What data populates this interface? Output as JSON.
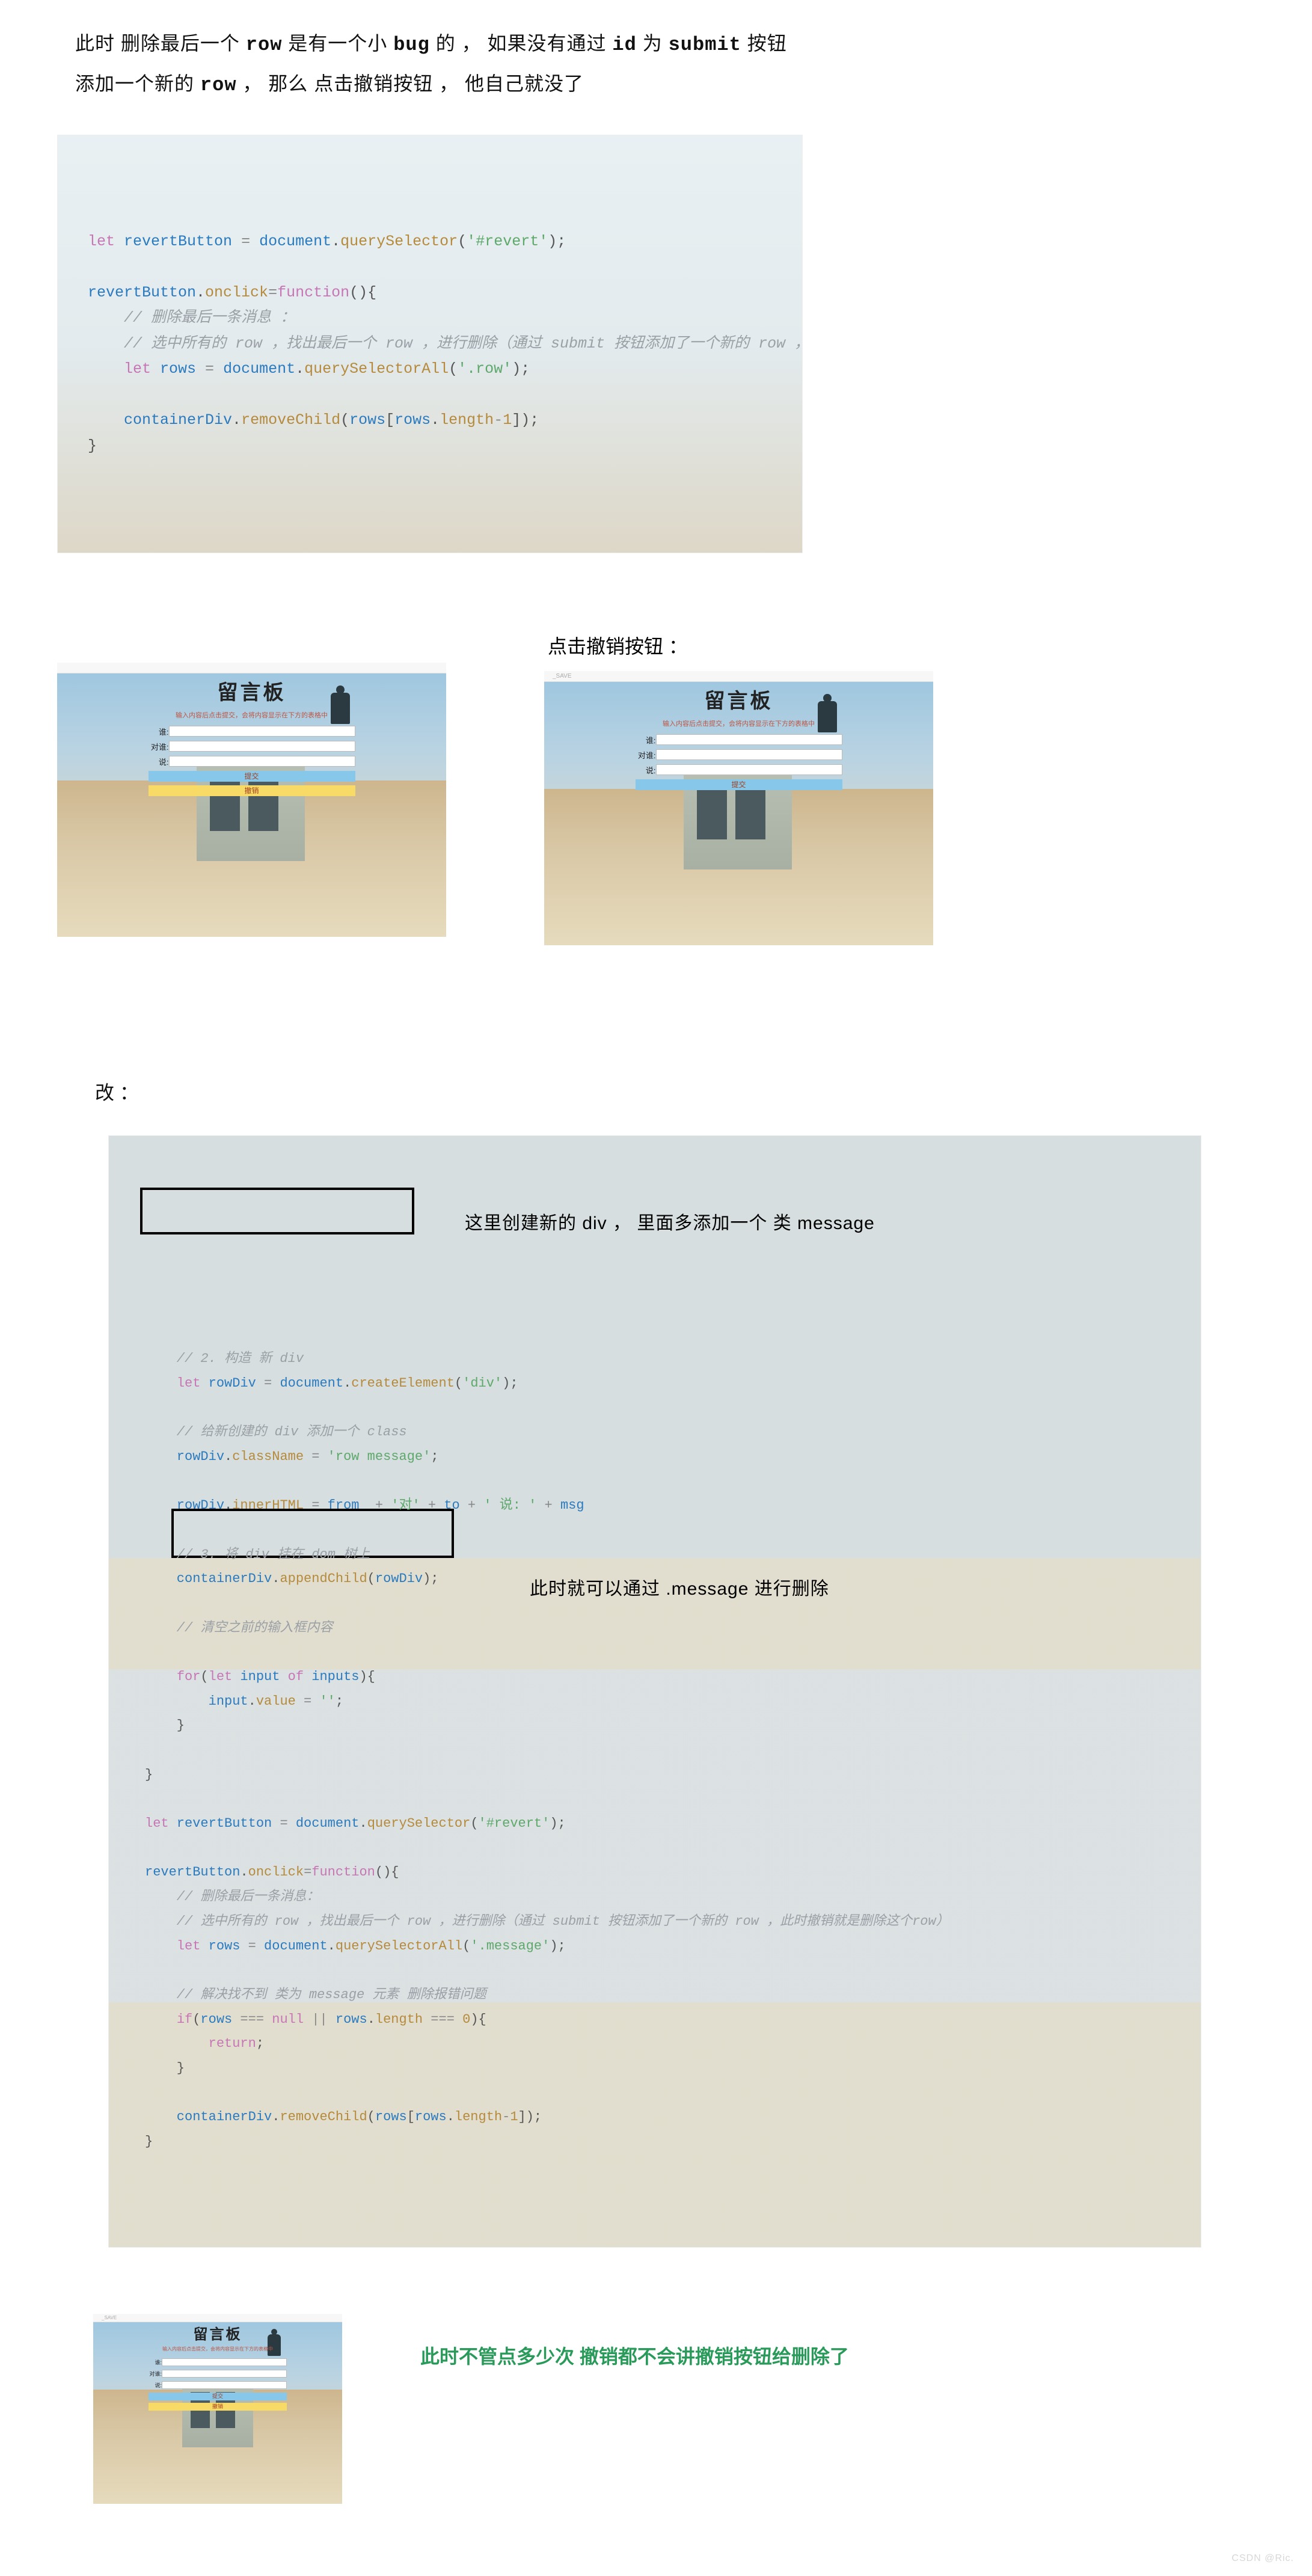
{
  "intro_para": {
    "line1_seg1": "此时 删除最后一个 ",
    "line1_row": "row",
    "line1_seg2": " 是有一个小 ",
    "line1_bug": "bug",
    "line1_seg3": " 的 ， 如果没有通过 ",
    "line1_id": "id",
    "line1_seg4": " 为 ",
    "line1_submit": "submit",
    "line1_seg5": " 按钮",
    "line2_seg1": "添加一个新的 ",
    "line2_row": "row",
    "line2_seg2": " ， 那么 点击撤销按钮 ， 他自己就没了"
  },
  "code1": {
    "l1_let": "let",
    "l1_var": " revertButton",
    "l1_eq": " = ",
    "l1_doc": "document",
    "l1_dot": ".",
    "l1_fn": "querySelector",
    "l1_par": "(",
    "l1_str": "'#revert'",
    "l1_end": ");",
    "l2_a": "revertButton",
    "l2_b": ".",
    "l2_c": "onclick",
    "l2_d": "=",
    "l2_e": "function",
    "l2_f": "(){",
    "c1": "    // 删除最后一条消息 ：",
    "c2": "    // 选中所有的 row ，找出最后一个 row ，进行删除（通过 submit 按钮添加了一个新的 row ，此时撤销就是删除这个row）",
    "l3_a": "    ",
    "l3_let": "let",
    "l3_var": " rows",
    "l3_eq": " = ",
    "l3_doc": "document",
    "l3_dot": ".",
    "l3_fn": "querySelectorAll",
    "l3_par": "(",
    "l3_str": "'.row'",
    "l3_end": ");",
    "l4_a": "    containerDiv",
    "l4_dot": ".",
    "l4_fn": "removeChild",
    "l4_par": "(",
    "l4_rows": "rows",
    "l4_br": "[",
    "l4_rows2": "rows",
    "l4_dot2": ".",
    "l4_len": "length",
    "l4_minus": "-",
    "l4_one": "1",
    "l4_end": "]);",
    "l5": "}"
  },
  "shot_label": "点击撤销按钮 ：",
  "board": {
    "title": "留言板",
    "sub": "输入内容后点击提交，会将内容显示在下方的表格中",
    "label_who": "谁:",
    "label_to": "对谁:",
    "label_say": "说:",
    "submit": "提交",
    "revert": "撤销",
    "tab": "_SAVE"
  },
  "section_fix": "改 ：",
  "code2": {
    "c1": "    // 2. 构造 新 div",
    "l1": "    let rowDiv = document.createElement('div');",
    "l1_let": "let",
    "l1_id": " rowDiv",
    "l1_eq": " = ",
    "l1_doc": "document",
    "l1_dot": ".",
    "l1_fn": "createElement",
    "l1_p": "(",
    "l1_s": "'div'",
    "l1_e": ");",
    "c2": "    // 给新创建的 div 添加一个 class",
    "l2_a": "    rowDiv",
    "l2_dot": ".",
    "l2_cls": "className",
    "l2_eq": " = ",
    "l2_s": "'row message'",
    "l2_e": ";",
    "l3_a": "    rowDiv",
    "l3_dot": ".",
    "l3_ih": "innerHTML",
    "l3_eq": " = ",
    "l3_from": "from",
    "l3_p2": "  + ",
    "l3_s1": "'对'",
    "l3_p3": " + ",
    "l3_to": "to",
    "l3_p4": " + ",
    "l3_s2": "' 说: '",
    "l3_p5": " + ",
    "l3_msg": "msg",
    "c3": "    // 3. 将 div 挂在 dom 树上",
    "l4_a": "    containerDiv",
    "l4_dot": ".",
    "l4_fn": "appendChild",
    "l4_p": "(",
    "l4_r": "rowDiv",
    "l4_e": ");",
    "c4": "    // 清空之前的输入框内容",
    "l5_a": "    ",
    "l5_for": "for",
    "l5_p": "(",
    "l5_let": "let",
    "l5_inp": " input ",
    "l5_of": "of",
    "l5_ins": " inputs",
    "l5_pe": "){",
    "l6": "        input.value = '';",
    "l6_a": "        input",
    "l6_dot": ".",
    "l6_v": "value",
    "l6_eq": " = ",
    "l6_s": "''",
    "l6_e": ";",
    "l7": "    }",
    "l8": "}",
    "l9_let": "let",
    "l9_v": " revertButton",
    "l9_eq": " = ",
    "l9_doc": "document",
    "l9_dot": ".",
    "l9_fn": "querySelector",
    "l9_p": "(",
    "l9_s": "'#revert'",
    "l9_e": ");",
    "l10_a": "revertButton",
    "l10_dot": ".",
    "l10_c": "onclick",
    "l10_eq": "=",
    "l10_fn": "function",
    "l10_p": "(){",
    "c5": "    // 删除最后一条消息：",
    "c6": "    // 选中所有的 row ，找出最后一个 row ，进行删除（通过 submit 按钮添加了一个新的 row ，此时撤销就是删除这个row）",
    "l11_a": "    ",
    "l11_let": "let",
    "l11_v": " rows",
    "l11_eq": " = ",
    "l11_doc": "document",
    "l11_dot": ".",
    "l11_fn": "querySelectorAll",
    "l11_p": "(",
    "l11_s": "'.message'",
    "l11_e": ");",
    "c7": "    // 解决找不到 类为 message 元素 删除报错问题",
    "l12_a": "    ",
    "l12_if": "if",
    "l12_p": "(",
    "l12_r": "rows",
    "l12_eq": " === ",
    "l12_null": "null",
    "l12_or": " || ",
    "l12_r2": "rows",
    "l12_dot": ".",
    "l12_len": "length",
    "l12_eq2": " === ",
    "l12_z": "0",
    "l12_pe": "){",
    "l13": "        return;",
    "l13_a": "        ",
    "l13_r": "return",
    "l13_e": ";",
    "l14": "    }",
    "l15_a": "    containerDiv",
    "l15_dot": ".",
    "l15_fn": "removeChild",
    "l15_p": "(",
    "l15_r": "rows",
    "l15_b": "[",
    "l15_r2": "rows",
    "l15_d2": ".",
    "l15_len": "length",
    "l15_m": "-",
    "l15_1": "1",
    "l15_e": "]);",
    "l16": "}"
  },
  "callouts": {
    "a": "这里创建新的 div ， 里面多添加一个 类 message",
    "b": "此时就可以通过 .message 进行删除"
  },
  "green_note": "此时不管点多少次  撤销都不会讲撤销按钮给删除了",
  "watermark": "CSDN @Ric."
}
